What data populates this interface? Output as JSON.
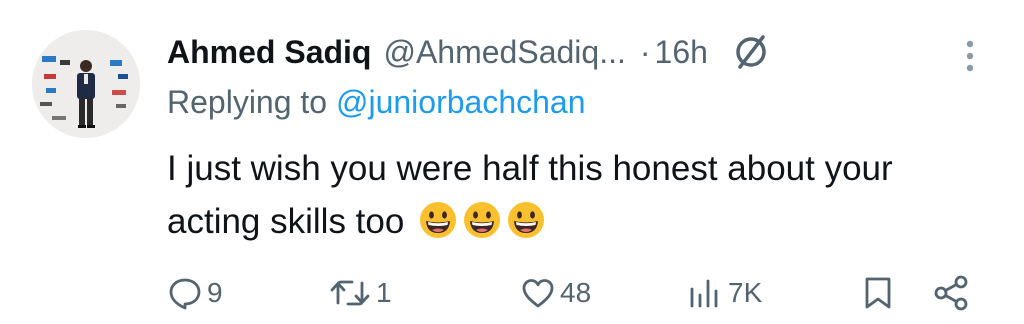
{
  "tweet": {
    "author_name": "Ahmed Sadiq",
    "author_handle": "@AhmedSadiq...",
    "separator": "·",
    "time": "16h",
    "replying_prefix": "Replying to ",
    "replying_to": "@juniorbachchan",
    "text": "I just wish you were half this honest about your acting skills too",
    "emojis": [
      "grinning-face-emoji",
      "grinning-face-emoji",
      "grinning-face-emoji"
    ]
  },
  "actions": {
    "replies": "9",
    "retweets": "1",
    "likes": "48",
    "views": "7K"
  },
  "icons": {
    "grok": "grok-icon",
    "more": "more-vertical-icon",
    "reply": "reply-icon",
    "retweet": "retweet-icon",
    "like": "heart-icon",
    "views": "views-chart-icon",
    "bookmark": "bookmark-icon",
    "share": "share-icon"
  },
  "colors": {
    "text": "#0f1419",
    "secondary": "#536471",
    "link": "#1d9bf0",
    "emoji": "#fbc02d"
  }
}
